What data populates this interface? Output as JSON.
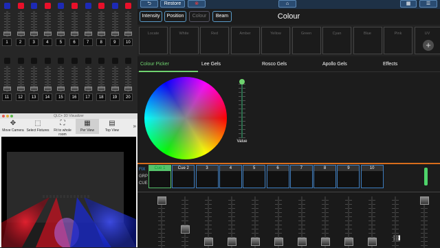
{
  "faders": {
    "row1": [
      "1",
      "2",
      "3",
      "4",
      "5",
      "6",
      "7",
      "8",
      "9",
      "10"
    ],
    "row2": [
      "11",
      "12",
      "13",
      "14",
      "15",
      "16",
      "17",
      "18",
      "19",
      "20"
    ],
    "row1_led_colors": [
      "#1d2ab5",
      "#e8102a",
      "#1d2ab5",
      "#e8102a",
      "#1d2ab5",
      "#e8102a",
      "#1d2ab5",
      "#e8102a",
      "#1d2ab5",
      "#e8102a"
    ]
  },
  "visualizer": {
    "title": "QLC+ 3D Visualizer",
    "tools": [
      {
        "label": "Move Camera",
        "icon": "move-icon"
      },
      {
        "label": "Select Fixtures",
        "icon": "select-icon"
      },
      {
        "label": "Fit to whole room",
        "icon": "fit-icon"
      },
      {
        "label": "Per View",
        "icon": "perspective-icon"
      },
      {
        "label": "Top View",
        "icon": "top-view-icon"
      }
    ]
  },
  "topbar": {
    "back_icon": "back-arrow-icon",
    "restore_label": "Restore",
    "clear_icon": "clear-icon",
    "home_icon": "home-icon",
    "grid_icon": "grid-icon",
    "menu_icon": "menu-icon"
  },
  "tabs": [
    {
      "label": "Intensity"
    },
    {
      "label": "Position"
    },
    {
      "label": "Colour"
    },
    {
      "label": "Beam"
    }
  ],
  "page_title": "Colour",
  "presets": [
    "Locate",
    "White",
    "Red",
    "Amber",
    "Yellow",
    "Green",
    "Cyan",
    "Blue",
    "Pink",
    "UV"
  ],
  "add_label": "+",
  "colour_tabs": [
    "Colour Picker",
    "Lee Gels",
    "Rosco Gels",
    "Apollo Gels",
    "Effects"
  ],
  "value_label": "Value",
  "row_labels": [
    "FIX",
    "GRP",
    "CUE"
  ],
  "cues": [
    "Cue 1",
    "Cue 2",
    "3",
    "4",
    "5",
    "6",
    "7",
    "8",
    "9",
    "10"
  ],
  "pause_symbol": "❚❚",
  "colors": {
    "accent_green": "#6fd36f",
    "cue_border": "#3d7dc0",
    "divider_orange": "#d96d1c",
    "topbar_blue": "#2a4c72"
  }
}
